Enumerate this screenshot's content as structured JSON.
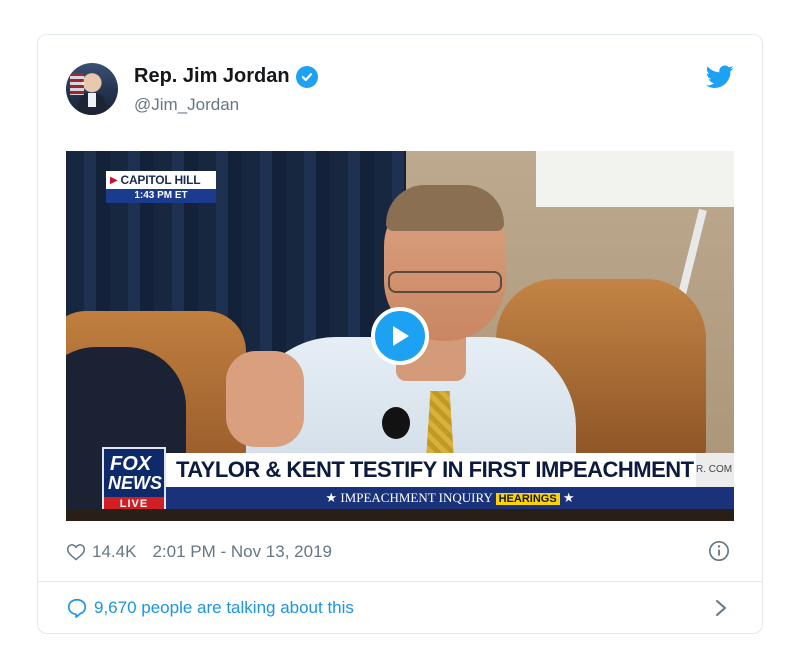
{
  "tweet": {
    "author_name": "Rep. Jim Jordan",
    "author_handle": "@Jim_Jordan",
    "likes": "14.4K",
    "timestamp": "2:01 PM - Nov 13, 2019",
    "talking_text": "9,670 people are talking about this"
  },
  "video": {
    "location_bug": "CAPITOL HILL",
    "time_bug": "1:43 PM ET",
    "logo_line1": "FOX",
    "logo_line2": "NEWS",
    "logo_live": "LIVE",
    "headline": "TAYLOR & KENT TESTIFY IN FIRST IMPEACHMENT HEARING",
    "side_tag": "R. COM",
    "subtitle_prefix": "★ IMPEACHMENT INQUIRY",
    "subtitle_highlight": "HEARINGS",
    "subtitle_suffix": "★"
  },
  "icons": {
    "verified": "verified-badge-icon",
    "twitter": "twitter-bird-icon",
    "play": "play-icon",
    "heart": "heart-icon",
    "info": "info-icon",
    "comment": "comment-bubble-icon",
    "chevron": "chevron-right-icon"
  },
  "colors": {
    "twitter_blue": "#1da1f2",
    "link_blue": "#1b95e0",
    "muted_text": "#657786",
    "name_text": "#14171a",
    "border": "#e1e8ed"
  }
}
